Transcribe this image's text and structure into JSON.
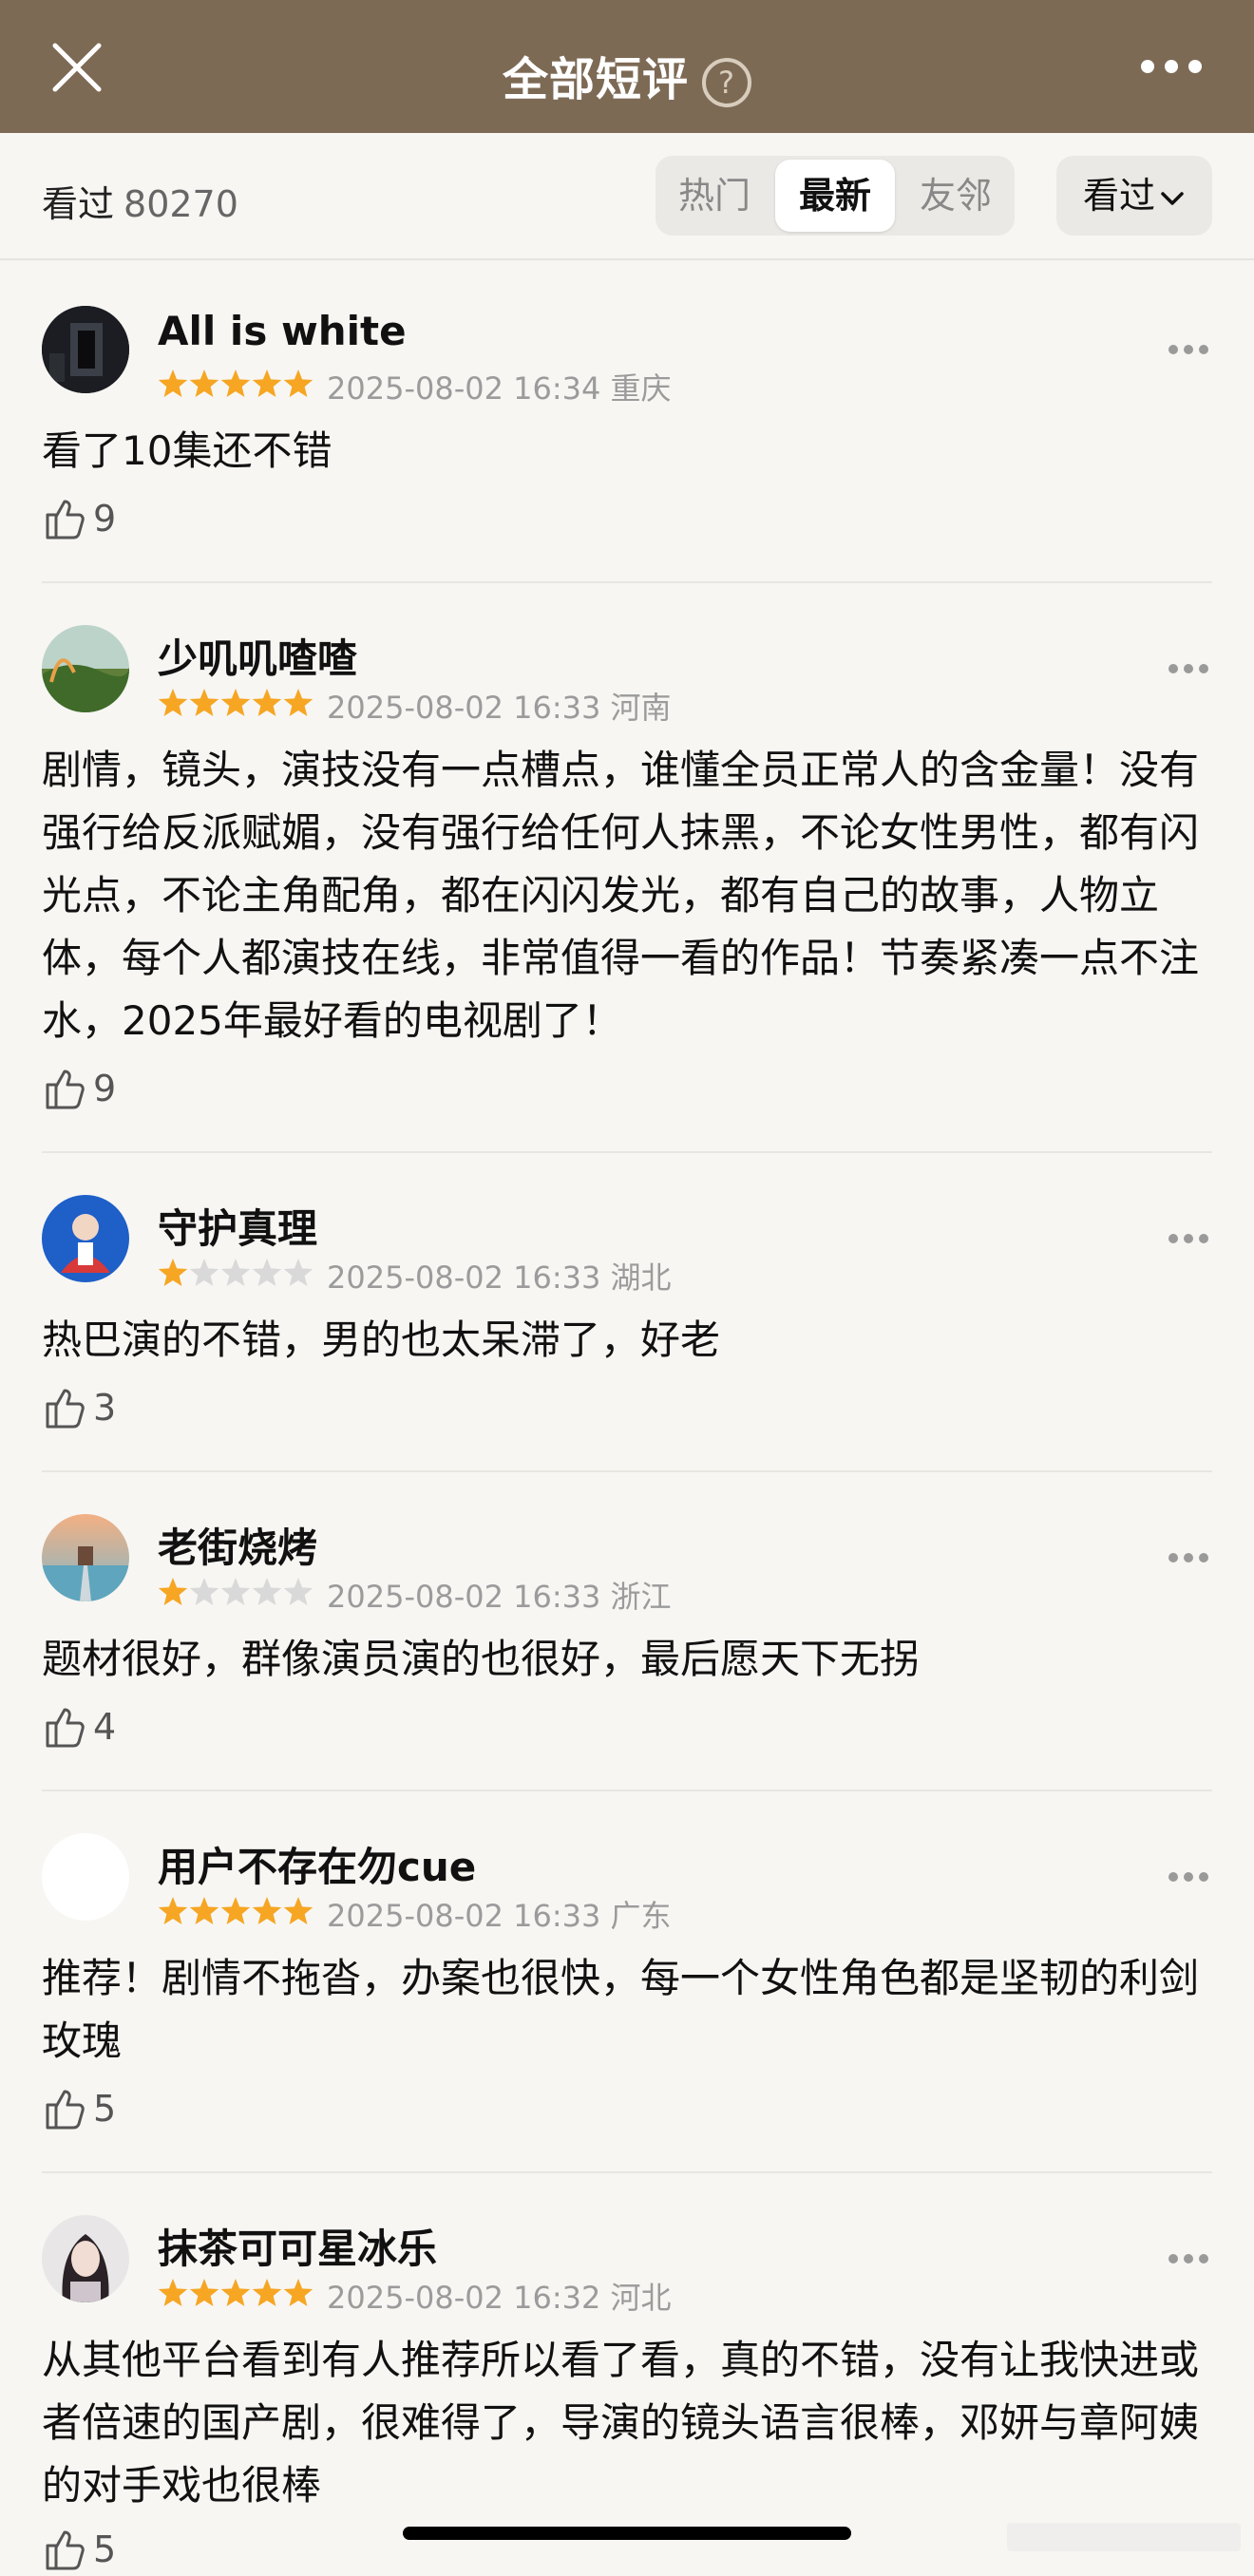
{
  "header": {
    "title": "全部短评",
    "help_icon": "?"
  },
  "filter": {
    "count_label": "看过",
    "count_value": "80270",
    "tabs": [
      {
        "label": "热门",
        "active": false
      },
      {
        "label": "最新",
        "active": true
      },
      {
        "label": "友邻",
        "active": false
      }
    ],
    "sort_label": "看过"
  },
  "reviews": [
    {
      "username": "All is white",
      "rating": 5,
      "datetime": "2025-08-02 16:34",
      "location": "重庆",
      "content": "看了10集还不错",
      "likes": "9"
    },
    {
      "username": "少叽叽喳喳",
      "rating": 5,
      "datetime": "2025-08-02 16:33",
      "location": "河南",
      "content": "剧情，镜头，演技没有一点槽点，谁懂全员正常人的含金量！没有强行给反派赋媚，没有强行给任何人抹黑，不论女性男性，都有闪光点，不论主角配角，都在闪闪发光，都有自己的故事，人物立体，每个人都演技在线，非常值得一看的作品！节奏紧凑一点不注水，2025年最好看的电视剧了！",
      "likes": "9"
    },
    {
      "username": "守护真理",
      "rating": 1,
      "datetime": "2025-08-02 16:33",
      "location": "湖北",
      "content": "热巴演的不错，男的也太呆滞了，好老",
      "likes": "3"
    },
    {
      "username": "老街烧烤",
      "rating": 1,
      "datetime": "2025-08-02 16:33",
      "location": "浙江",
      "content": "题材很好，群像演员演的也很好，最后愿天下无拐",
      "likes": "4"
    },
    {
      "username": "用户不存在勿cue",
      "rating": 5,
      "datetime": "2025-08-02 16:33",
      "location": "广东",
      "content": "推荐！剧情不拖沓，办案也很快，每一个女性角色都是坚韧的利剑玫瑰",
      "likes": "5"
    },
    {
      "username": "抹茶可可星冰乐",
      "rating": 5,
      "datetime": "2025-08-02 16:32",
      "location": "河北",
      "content": "从其他平台看到有人推荐所以看了看，真的不错，没有让我快进或者倍速的国产剧，很难得了，导演的镜头语言很棒，邓妍与章阿姨的对手戏也很棒",
      "likes": "5"
    }
  ],
  "colors": {
    "header_bg": "#7d6a55",
    "star_filled": "#f6a623",
    "star_empty": "#d9d9d9"
  }
}
